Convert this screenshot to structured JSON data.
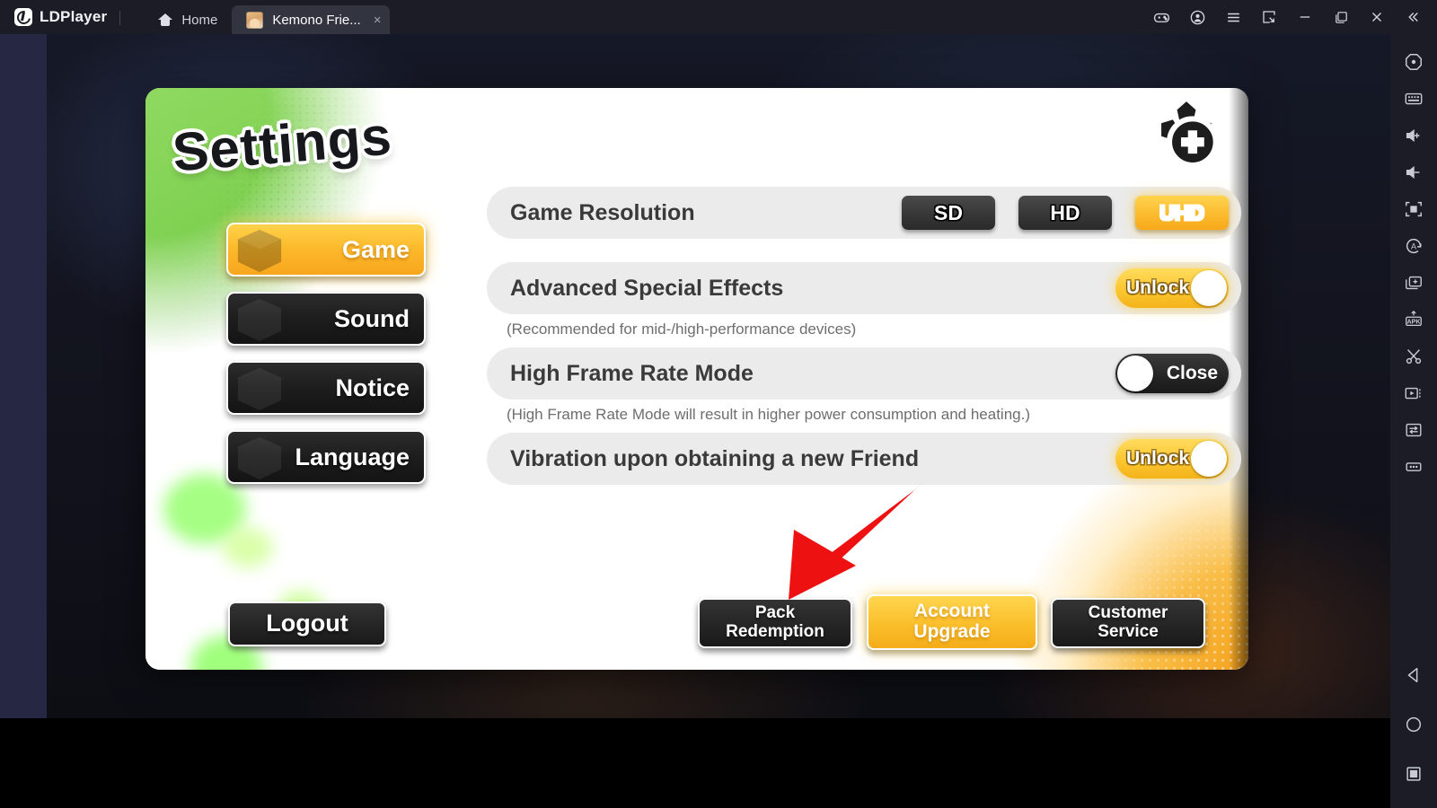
{
  "titlebar": {
    "brand": "LDPlayer",
    "tabs": [
      {
        "label": "Home",
        "icon": "home-icon",
        "active": false
      },
      {
        "label": "Kemono Frie...",
        "icon": "app-avatar-icon",
        "active": true,
        "close": "×"
      }
    ],
    "window_controls": [
      {
        "name": "gamepad-icon"
      },
      {
        "name": "account-icon"
      },
      {
        "name": "menu-icon"
      },
      {
        "name": "shrink-window-icon"
      },
      {
        "name": "minimize-icon"
      },
      {
        "name": "maximize-icon"
      },
      {
        "name": "close-icon"
      },
      {
        "name": "collapse-toolbar-icon"
      }
    ]
  },
  "sidebar": {
    "items": [
      {
        "name": "home-hex-icon"
      },
      {
        "name": "keyboard-icon"
      },
      {
        "name": "volume-up-icon"
      },
      {
        "name": "volume-down-icon"
      },
      {
        "name": "fullscreen-icon"
      },
      {
        "name": "auto-rotate-icon"
      },
      {
        "name": "multi-instance-icon"
      },
      {
        "name": "install-apk-icon"
      },
      {
        "name": "screenshot-scissors-icon"
      },
      {
        "name": "video-record-icon"
      },
      {
        "name": "shared-folder-icon"
      },
      {
        "name": "more-options-icon"
      }
    ],
    "nav": [
      {
        "name": "android-back-icon"
      },
      {
        "name": "android-home-icon"
      },
      {
        "name": "android-recents-icon"
      }
    ]
  },
  "panel": {
    "title": "Settings",
    "logo": "paw-cross-logo",
    "nav": [
      {
        "label": "Game",
        "active": true
      },
      {
        "label": "Sound",
        "active": false
      },
      {
        "label": "Notice",
        "active": false
      },
      {
        "label": "Language",
        "active": false
      }
    ],
    "rows": [
      {
        "type": "options",
        "label": "Game Resolution",
        "options": [
          {
            "label": "SD",
            "selected": false
          },
          {
            "label": "HD",
            "selected": false
          },
          {
            "label": "UHD",
            "selected": true
          }
        ]
      },
      {
        "type": "toggle",
        "label": "Advanced Special Effects",
        "toggle": {
          "state": "on",
          "label": "Unlock"
        },
        "note": "(Recommended for mid-/high-performance devices)"
      },
      {
        "type": "toggle",
        "label": "High Frame Rate Mode",
        "toggle": {
          "state": "off",
          "label": "Close"
        },
        "note": "(High Frame Rate Mode will result in higher power consumption and heating.)"
      },
      {
        "type": "toggle",
        "label": "Vibration upon obtaining a new Friend",
        "toggle": {
          "state": "on",
          "label": "Unlock"
        },
        "note": ""
      }
    ],
    "buttons": {
      "logout": "Logout",
      "pack_redemption_line1": "Pack",
      "pack_redemption_line2": "Redemption",
      "account_upgrade_line1": "Account",
      "account_upgrade_line2": "Upgrade",
      "customer_service_line1": "Customer",
      "customer_service_line2": "Service"
    }
  },
  "annotation": {
    "arrow": {
      "color": "#ee1111",
      "points_to": "account-upgrade-button"
    }
  },
  "colors": {
    "accent_gold": "#fbc02e",
    "panel_green": "#7ccf4e",
    "panel_orange": "#f5a21d",
    "chrome_dark": "#1b1c26",
    "arrow_red": "#ee1111"
  }
}
